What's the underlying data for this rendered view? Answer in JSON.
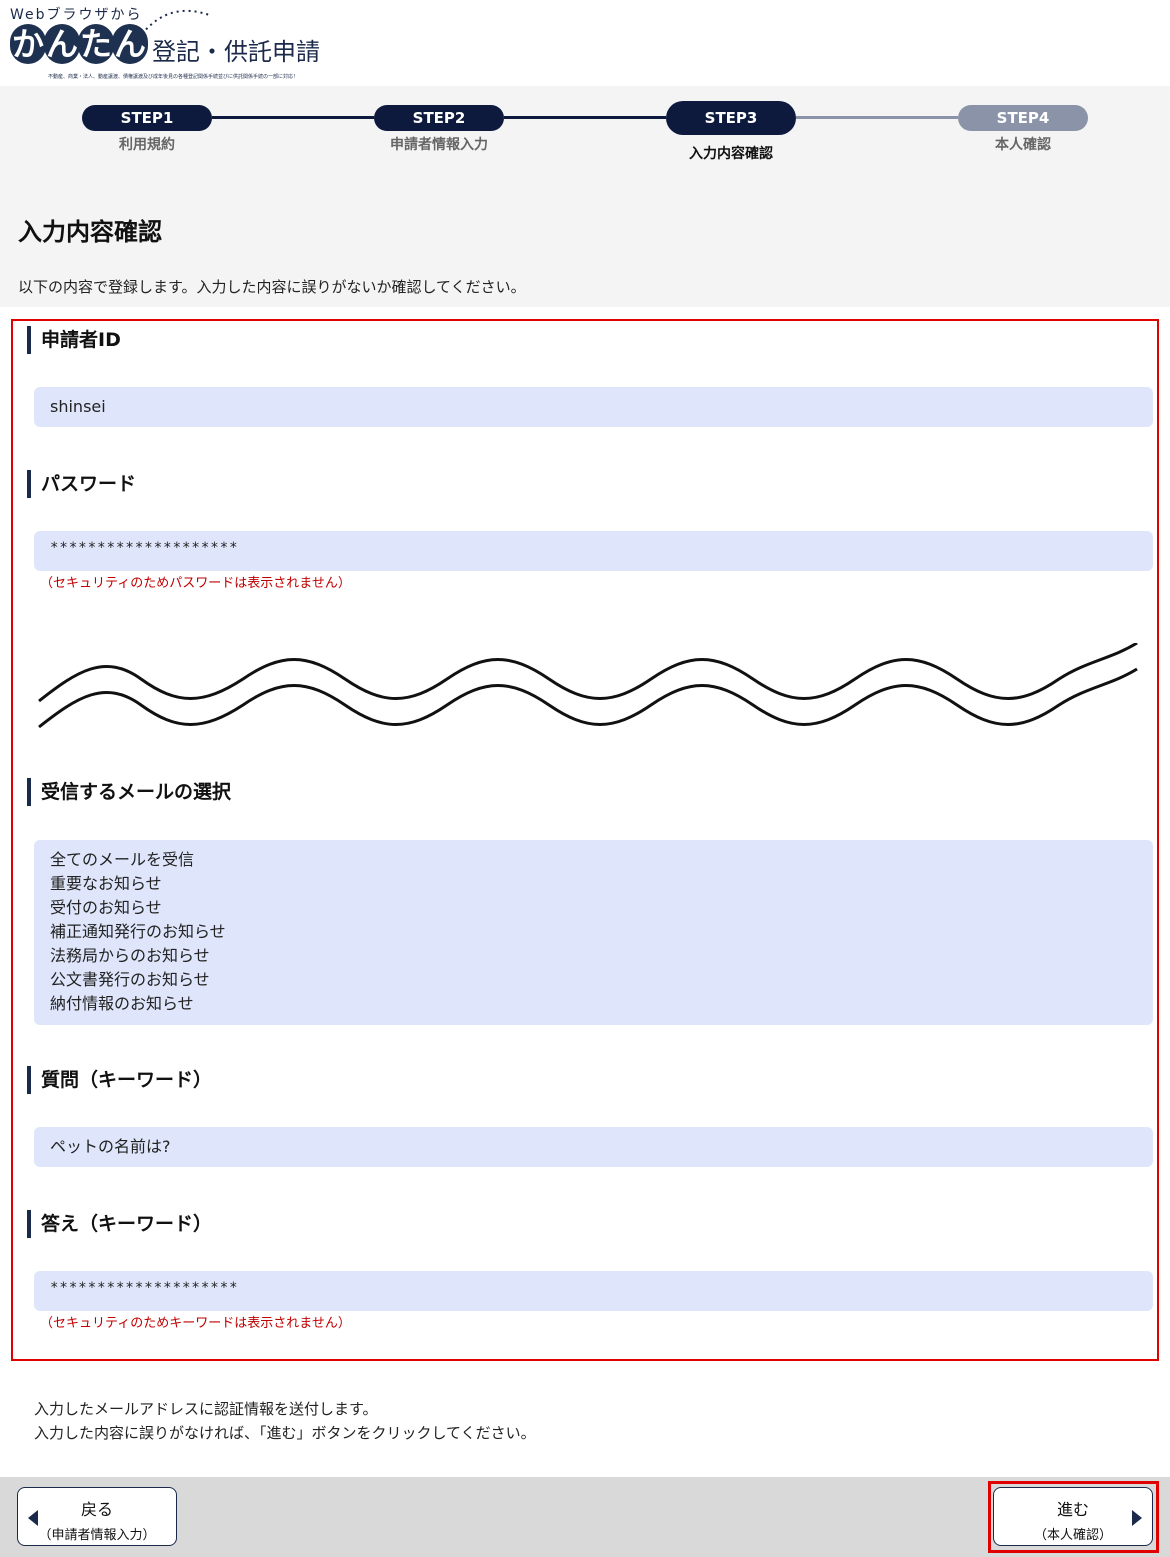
{
  "header": {
    "logo_top": "Webブラウザから",
    "logo_kantan": [
      "か",
      "ん",
      "た",
      "ん"
    ],
    "logo_main": "登記・供託申請",
    "logo_sub": "不動産、商業・法人、動産譲渡、債権譲渡及び成年後見の各種登記関係手続並びに供託関係手続の一部に対応！"
  },
  "steps": [
    {
      "pill": "STEP1",
      "label": "利用規約",
      "color": "#0d1a3d"
    },
    {
      "pill": "STEP2",
      "label": "申請者情報入力",
      "color": "#0d1a3d"
    },
    {
      "pill": "STEP3",
      "label": "入力内容確認",
      "color": "#0d1a3d"
    },
    {
      "pill": "STEP4",
      "label": "本人確認",
      "color": "#8a93a8"
    }
  ],
  "page_title": "入力内容確認",
  "intro": "以下の内容で登録します。入力した内容に誤りがないか確認してください。",
  "sections": {
    "applicant_id": {
      "title": "申請者ID",
      "value": "shinsei"
    },
    "password": {
      "title": "パスワード",
      "value": "********************",
      "note": "（セキュリティのためパスワードは表示されません）"
    },
    "mail": {
      "title": "受信するメールの選択",
      "items": [
        "全てのメールを受信",
        "重要なお知らせ",
        "受付のお知らせ",
        "補正通知発行のお知らせ",
        "法務局からのお知らせ",
        "公文書発行のお知らせ",
        "納付情報のお知らせ"
      ]
    },
    "question": {
      "title": "質問（キーワード）",
      "value": "ペットの名前は?"
    },
    "answer": {
      "title": "答え（キーワード）",
      "value": "********************",
      "note": "（セキュリティのためキーワードは表示されません）"
    }
  },
  "footer": {
    "line1": "入力したメールアドレスに認証情報を送付します。",
    "line2": "入力した内容に誤りがなければ、「進む」ボタンをクリックしてください。"
  },
  "buttons": {
    "back_main": "戻る",
    "back_sub": "（申請者情報入力）",
    "next_main": "進む",
    "next_sub": "（本人確認）"
  },
  "colors": {
    "accent": "#1b2a4a",
    "highlight_border": "#e00000",
    "value_bg": "#dfe6fb",
    "note": "#c00000"
  }
}
